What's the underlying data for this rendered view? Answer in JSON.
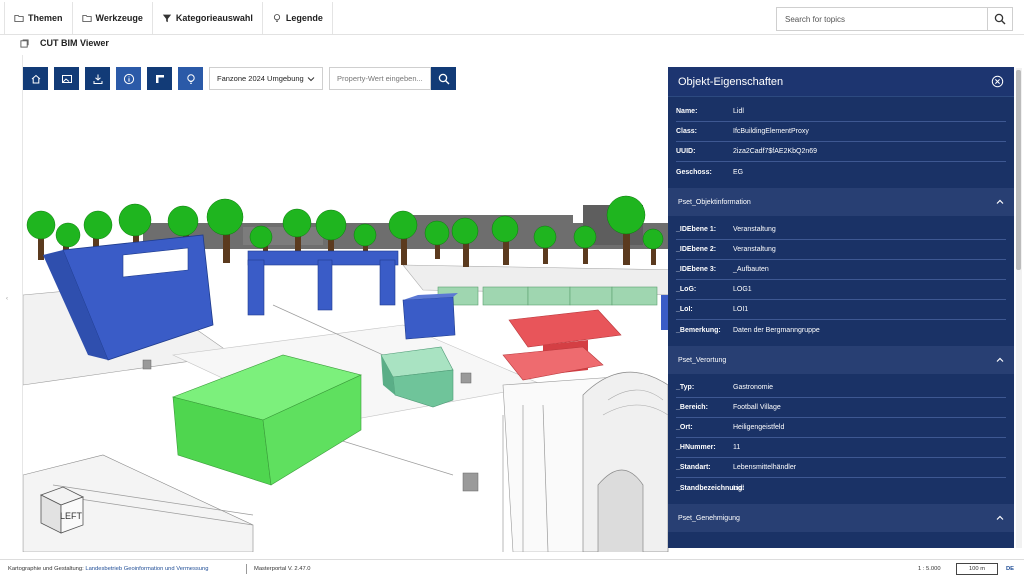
{
  "menu": {
    "items": [
      {
        "label": "Themen",
        "icon": "folder-icon"
      },
      {
        "label": "Werkzeuge",
        "icon": "folder-icon"
      },
      {
        "label": "Kategorieauswahl",
        "icon": "filter-icon"
      },
      {
        "label": "Legende",
        "icon": "lightbulb-icon"
      }
    ]
  },
  "search": {
    "placeholder": "Search for topics"
  },
  "window": {
    "title": "CUT BIM Viewer"
  },
  "toolbar": {
    "select_value": "Fanzone 2024 Umgebung",
    "property_placeholder": "Property-Wert eingeben..."
  },
  "viewcube": {
    "label": "LEFT"
  },
  "panel": {
    "title": "Objekt-Eigenschaften",
    "main": [
      {
        "k": "Name:",
        "v": "Lidl"
      },
      {
        "k": "Class:",
        "v": "IfcBuildingElementProxy"
      },
      {
        "k": "UUID:",
        "v": "2iza2Cadf7$fAE2KbQ2n69"
      },
      {
        "k": "Geschoss:",
        "v": "EG"
      }
    ],
    "sections": [
      {
        "title": "Pset_Objektinformation",
        "rows": [
          {
            "k": "_IDEbene 1:",
            "v": "Veranstaltung"
          },
          {
            "k": "_IDEbene 2:",
            "v": "Veranstaltung"
          },
          {
            "k": "_IDEbene 3:",
            "v": "_Aufbauten"
          },
          {
            "k": "_LoG:",
            "v": "LOG1"
          },
          {
            "k": "_LoI:",
            "v": "LOI1"
          },
          {
            "k": "_Bemerkung:",
            "v": "Daten der Bergmanngruppe"
          }
        ]
      },
      {
        "title": "Pset_Verortung",
        "rows": [
          {
            "k": "_Typ:",
            "v": "Gastronomie"
          },
          {
            "k": "_Bereich:",
            "v": "Football Village"
          },
          {
            "k": "_Ort:",
            "v": "Heiligengeistfeld"
          },
          {
            "k": "_HNummer:",
            "v": "11"
          },
          {
            "k": "_Standart:",
            "v": "Lebensmittelhändler"
          },
          {
            "k": "_Standbezeichnung:",
            "v": "Lidl"
          }
        ]
      },
      {
        "title": "Pset_Genehmigung",
        "rows": []
      }
    ]
  },
  "footer": {
    "credit_label": "Kartographie und Gestaltung:",
    "credit_link": "Landesbetrieb Geoinformation und Vermessung",
    "version": "Masterportal V. 2.47.0",
    "scale": "1 : 5.000",
    "scale_bar": "100 m",
    "language": "DE"
  },
  "colors": {
    "navy": "#123b77",
    "panel": "#1a3266",
    "section": "#283f73",
    "green_box": "#4fd64f",
    "blue_building": "#3a5cc7",
    "red_stand": "#e8555a",
    "teal_box": "#6fc49a"
  }
}
